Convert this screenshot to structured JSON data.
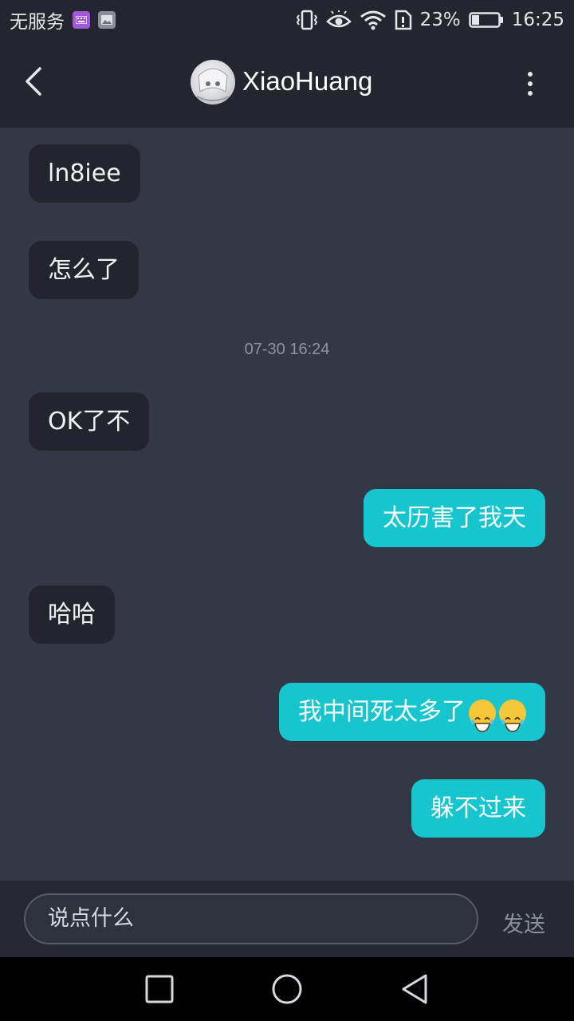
{
  "status_bar": {
    "carrier": "无服务",
    "battery": "23%",
    "time": "16:25"
  },
  "header": {
    "title": "XiaoHuang"
  },
  "messages": [
    {
      "side": "left",
      "text": "ln8iee"
    },
    {
      "side": "left",
      "text": "怎么了"
    },
    {
      "timestamp": "07-30 16:24"
    },
    {
      "side": "left",
      "text": "OK了不"
    },
    {
      "side": "right",
      "text": "太历害了我天"
    },
    {
      "side": "left",
      "text": "哈哈"
    },
    {
      "side": "right",
      "text": "我中间死太多了",
      "emoji": [
        "laughing-emoji",
        "laughing-emoji"
      ]
    },
    {
      "side": "right",
      "text": "躲不过来"
    }
  ],
  "composer": {
    "placeholder": "说点什么",
    "send_label": "发送"
  },
  "colors": {
    "background": "#333846",
    "header": "#24262f",
    "incoming_bubble": "#23252e",
    "outgoing_bubble": "#17c5cf"
  },
  "icons": [
    "keyboard-icon",
    "image-icon",
    "vibrate-icon",
    "eye-icon",
    "wifi-icon",
    "sim-icon",
    "battery-icon",
    "back-icon",
    "more-icon",
    "nav-square-icon",
    "nav-circle-icon",
    "nav-back-icon"
  ]
}
